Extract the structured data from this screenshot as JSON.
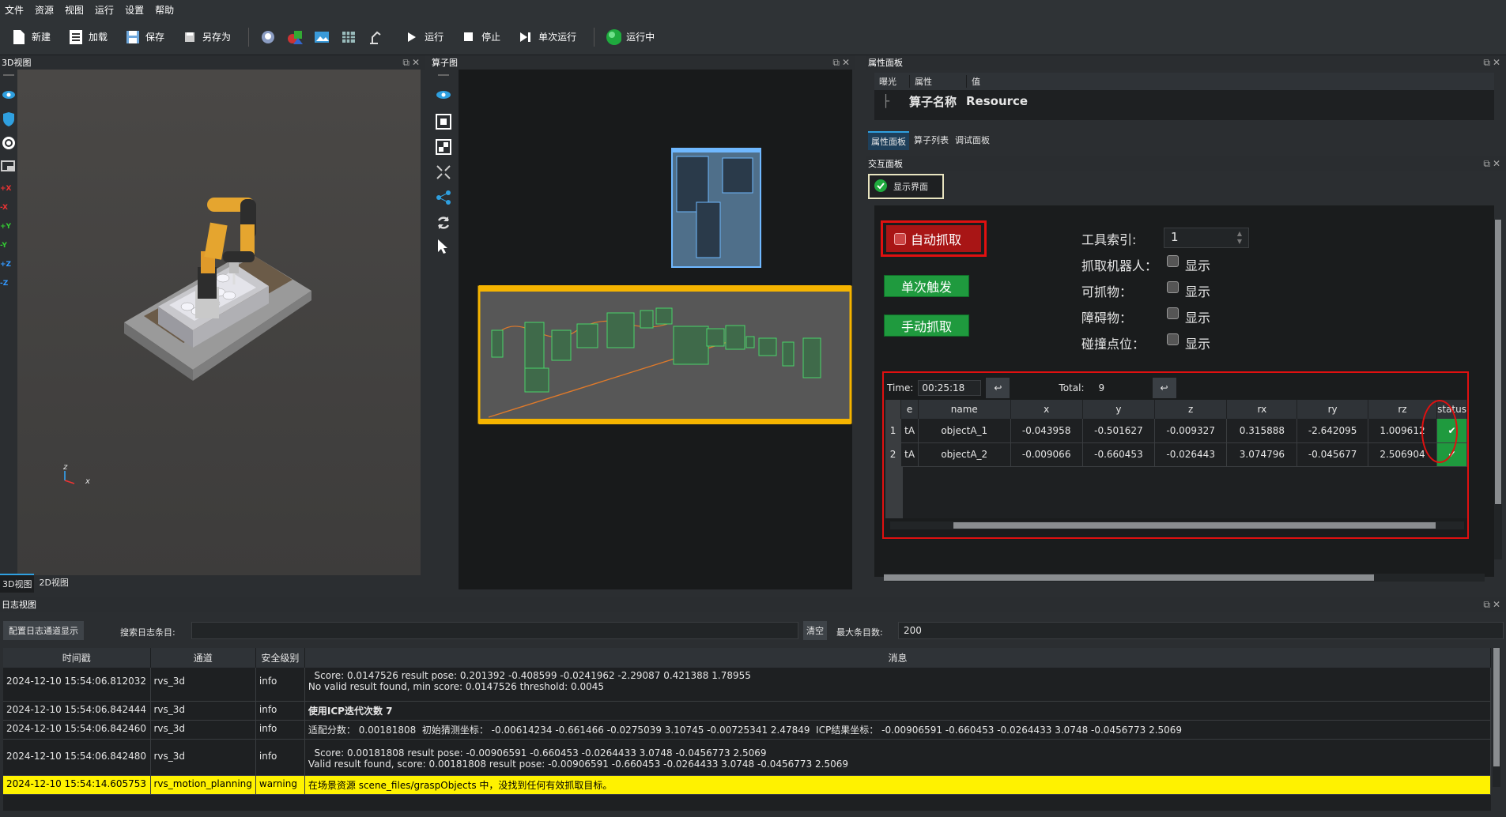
{
  "menu": [
    "文件",
    "资源",
    "视图",
    "运行",
    "设置",
    "帮助"
  ],
  "toolbar": {
    "new_label": "新建",
    "load_label": "加载",
    "save_label": "保存",
    "saveas_label": "另存为",
    "run_label": "运行",
    "stop_label": "停止",
    "single_run_label": "单次运行",
    "running_label": "运行中"
  },
  "view3d": {
    "title": "3D视图",
    "tabs": [
      "3D视图",
      "2D视图"
    ],
    "axis_z": "z",
    "axis_x": "x",
    "tool_labels": [
      "+X",
      "-X",
      "+Y",
      "-Y",
      "+Z",
      "-Z"
    ]
  },
  "operator_graph": {
    "title": "算子图"
  },
  "property_panel": {
    "title": "属性面板",
    "headers": [
      "曝光",
      "属性",
      "值"
    ],
    "row_label": "算子名称",
    "row_value": "Resource",
    "tabs": [
      "属性面板",
      "算子列表",
      "调试面板"
    ]
  },
  "interaction_panel": {
    "title": "交互面板",
    "show_ui_label": "显示界面",
    "auto_grab_label": "自动抓取",
    "single_trigger_label": "单次触发",
    "manual_grab_label": "手动抓取",
    "tool_index_label": "工具索引:",
    "tool_index_value": "1",
    "grab_robot_label": "抓取机器人：",
    "grabbable_label": "可抓物：",
    "obstacle_label": "障碍物：",
    "collision_label": "碰撞点位：",
    "show_label": "显示",
    "time_label": "Time:",
    "time_value": "00:25:18",
    "total_label": "Total:",
    "total_value": "9",
    "columns": [
      "e",
      "name",
      "x",
      "y",
      "z",
      "rx",
      "ry",
      "rz",
      "status"
    ],
    "rows": [
      {
        "idx": "1",
        "e": "tA",
        "name": "objectA_1",
        "x": "-0.043958",
        "y": "-0.501627",
        "z": "-0.009327",
        "rx": "0.315888",
        "ry": "-2.642095",
        "rz": "1.009612",
        "status": "✔"
      },
      {
        "idx": "2",
        "e": "tA",
        "name": "objectA_2",
        "x": "-0.009066",
        "y": "-0.660453",
        "z": "-0.026443",
        "rx": "3.074796",
        "ry": "-0.045677",
        "rz": "2.506904",
        "status": "✔"
      }
    ]
  },
  "log_view": {
    "title": "日志视图",
    "config_button": "配置日志通道显示",
    "search_label": "搜索日志条目:",
    "search_value": "",
    "clear_button": "清空",
    "max_label": "最大条目数:",
    "max_value": "200",
    "columns": [
      "时间戳",
      "通道",
      "安全级别",
      "消息"
    ],
    "entries": [
      {
        "time": "2024-12-10 15:54:06.812032",
        "channel": "rvs_3d",
        "level": "info",
        "message": "  Score: 0.0147526 result pose: 0.201392 -0.408599 -0.0241962 -2.29087 0.421388 1.78955\nNo valid result found, min score: 0.0147526 threshold: 0.0045"
      },
      {
        "time": "2024-12-10 15:54:06.842444",
        "channel": "rvs_3d",
        "level": "info",
        "message": "使用ICP迭代次数 7"
      },
      {
        "time": "2024-12-10 15:54:06.842460",
        "channel": "rvs_3d",
        "level": "info",
        "message": "适配分数： 0.00181808  初始猜测坐标： -0.00614234 -0.661466 -0.0275039 3.10745 -0.00725341 2.47849  ICP结果坐标： -0.00906591 -0.660453 -0.0264433 3.0748 -0.0456773 2.5069"
      },
      {
        "time": "2024-12-10 15:54:06.842480",
        "channel": "rvs_3d",
        "level": "info",
        "message": "  Score: 0.00181808 result pose: -0.00906591 -0.660453 -0.0264433 3.0748 -0.0456773 2.5069\nValid result found, score: 0.00181808 result pose: -0.00906591 -0.660453 -0.0264433 3.0748 -0.0456773 2.5069"
      },
      {
        "time": "2024-12-10 15:54:14.605753",
        "channel": "rvs_motion_planning",
        "level": "warning",
        "message": "在场景资源 scene_files/graspObjects 中，没找到任何有效抓取目标。"
      }
    ]
  },
  "colors": {
    "accent_green": "#1f9a3e",
    "highlight_red": "#e01010",
    "warning_yellow": "#fff200",
    "orange_group": "#f5b400"
  }
}
